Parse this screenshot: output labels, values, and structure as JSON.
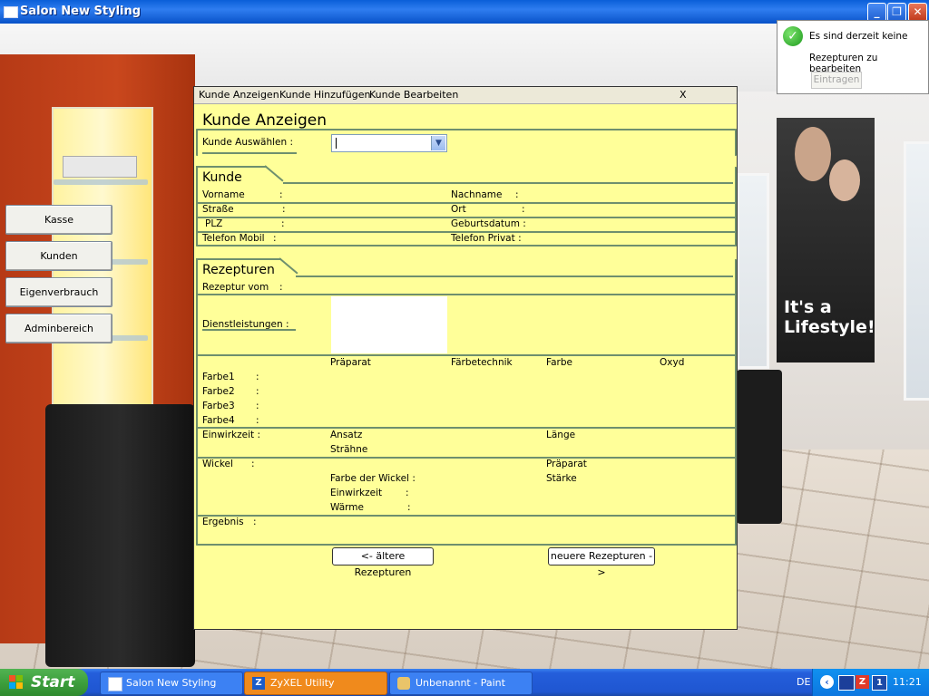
{
  "window": {
    "title": "Salon New Styling"
  },
  "side_buttons": [
    {
      "label": "Kasse"
    },
    {
      "label": "Kunden"
    },
    {
      "label": "Eigenverbrauch"
    },
    {
      "label": "Adminbereich"
    }
  ],
  "notification": {
    "line1": "Es sind derzeit keine",
    "line2": "Rezepturen zu bearbeiten",
    "button": "Eintragen"
  },
  "poster": {
    "line1": "It's a",
    "line2": "Lifestyle!"
  },
  "form": {
    "menu": [
      "Kunde Anzeigen",
      "Kunde Hinzufügen",
      "Kunde Bearbeiten"
    ],
    "close": "X",
    "title": "Kunde Anzeigen",
    "select_label": "Kunde Auswählen :",
    "select_value": "",
    "kunde_section": "Kunde",
    "kunde_fields": {
      "vorname": "Vorname",
      "nachname": "Nachname",
      "strasse": "Straße",
      "ort": "Ort",
      "plz": "PLZ",
      "geburtsdatum": "Geburtsdatum :",
      "telefon_mobil": "Telefon Mobil",
      "telefon_privat": "Telefon Privat :"
    },
    "rezeptur_section": "Rezepturen",
    "rezeptur_vom": "Rezeptur vom",
    "dienstleistungen": "Dienstleistungen :",
    "farbe_headers": [
      "Präparat",
      "Färbetechnik",
      "Farbe",
      "Oxyd"
    ],
    "farbe_rows": [
      "Farbe1",
      "Farbe2",
      "Farbe3",
      "Farbe4"
    ],
    "einwirkzeit": "Einwirkzeit :",
    "ansatz": "Ansatz",
    "straehne": "Strähne",
    "laenge": "Länge",
    "wickel": "Wickel",
    "farbe_der_wickel": "Farbe der Wickel :",
    "wickel_einwirkzeit": "Einwirkzeit",
    "waerme": "Wärme",
    "wickel_praeparat": "Präparat",
    "staerke": "Stärke",
    "ergebnis": "Ergebnis",
    "btn_older": "<- ältere Rezepturen",
    "btn_newer": "neuere Rezepturen ->"
  },
  "taskbar": {
    "start": "Start",
    "tasks": [
      "Salon New Styling",
      "ZyXEL Utility",
      "Unbenannt - Paint"
    ],
    "lang": "DE",
    "time": "11:21"
  },
  "colors": {
    "form_bg": "#ffff99",
    "xp_blue": "#245edb",
    "start_green": "#3d9f3d",
    "zyxel_task": "#f08a1c"
  }
}
